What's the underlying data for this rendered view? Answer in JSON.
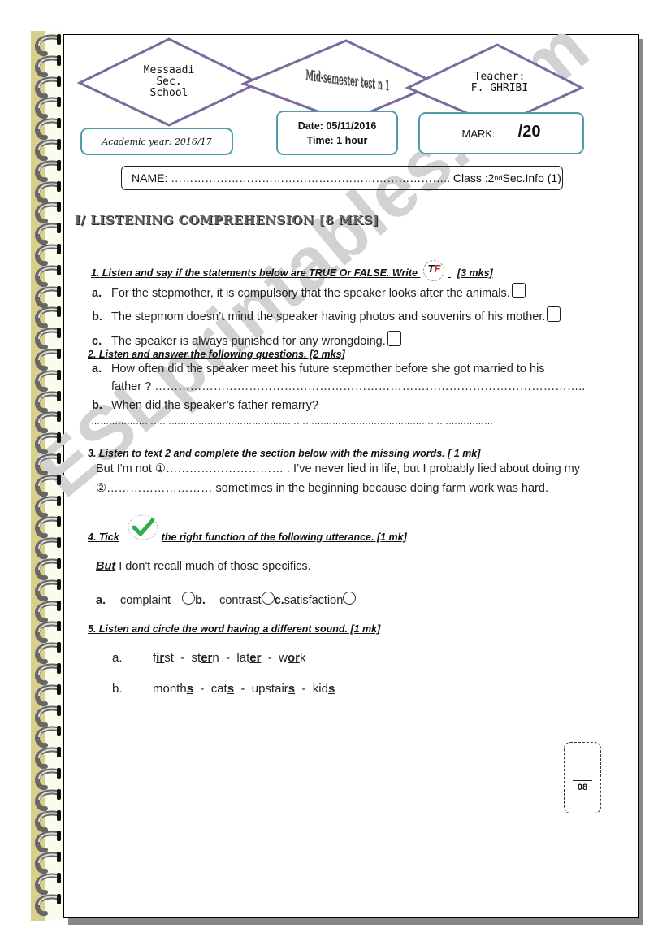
{
  "header": {
    "school": [
      "Messaadi",
      "Sec.",
      "School"
    ],
    "test_title": "Mid-semester test n 1",
    "teacher_label": "Teacher:",
    "teacher_name": "F. GHRIBI",
    "academic_year": "Academic year:  2016/17",
    "date": "Date: 05/11/2016",
    "time": "Time: 1 hour",
    "mark_label": "MARK:",
    "mark_total": "/20"
  },
  "name_line": {
    "label": "NAME: ……………………………………………………………….. Class :2",
    "class_sup": "nd",
    "class_rest": "Sec.Info (1)"
  },
  "section_title": "I/ LISTENING COMPREHENSION [8 MKS]",
  "q1": {
    "heading": "1. Listen and say if the statements below are TRUE Or FALSE. Write",
    "marks": "[3  mks]",
    "icon_letters": [
      "T",
      "F"
    ],
    "items": [
      {
        "label": "a.",
        "text": "For the stepmother, it is compulsory that the speaker looks after the animals."
      },
      {
        "label": "b.",
        "text": "The stepmom doesn’t mind the speaker having photos and souvenirs of his mother."
      },
      {
        "label": "c.",
        "text": "The speaker is always punished for any wrongdoing."
      }
    ]
  },
  "q2": {
    "heading": "2. Listen and answer the following questions. [2 mks]",
    "items": [
      {
        "label": "a.",
        "text": "How often did the speaker meet his future stepmother before she got married to his",
        "cont": "father ?   ……………………………………………………………………………………………….."
      },
      {
        "label": "b.",
        "text": "When did the speaker’s father remarry?",
        "cont": "………………………………………………………………………………………………………………………"
      }
    ]
  },
  "q3": {
    "heading": "3. Listen to text 2 and complete the section below with the missing words. [ 1 mk]",
    "line1": "But I'm not ①…………………………  . I’ve never lied in life, but I probably lied about doing my",
    "line2": "②……………………… sometimes in the beginning because doing farm work was hard."
  },
  "q4": {
    "heading_pre": "4. Tick",
    "heading_post": "the right function of the following utterance. [1 mk]",
    "utterance_keyword": "But",
    "utterance_rest": " I don't recall much of those specifics.",
    "options": [
      {
        "label": "a.",
        "text": "complaint"
      },
      {
        "label": "b.",
        "text": "contrast"
      },
      {
        "label": "c.",
        "text": "satisfaction"
      }
    ]
  },
  "q5": {
    "heading": "5. Listen and circle the word having a different sound. [1 mk]",
    "rows": [
      {
        "label": "a.",
        "words": [
          [
            "f",
            "ir",
            "st"
          ],
          [
            "st",
            "er",
            "n"
          ],
          [
            "lat",
            "er",
            ""
          ],
          [
            "w",
            "or",
            "k"
          ]
        ]
      },
      {
        "label": "b.",
        "words": [
          [
            "month",
            "s",
            ""
          ],
          [
            "cat",
            "s",
            ""
          ],
          [
            "upstair",
            "s",
            ""
          ],
          [
            "kid",
            "s",
            ""
          ]
        ]
      }
    ]
  },
  "score_box": {
    "total": "08"
  },
  "watermark": "ESLprintables.com",
  "colors": {
    "diamond": "#7b6a9c",
    "box_border": "#4f9dab",
    "watermark": "#d2d2d2",
    "spine": "#d8d08a"
  }
}
